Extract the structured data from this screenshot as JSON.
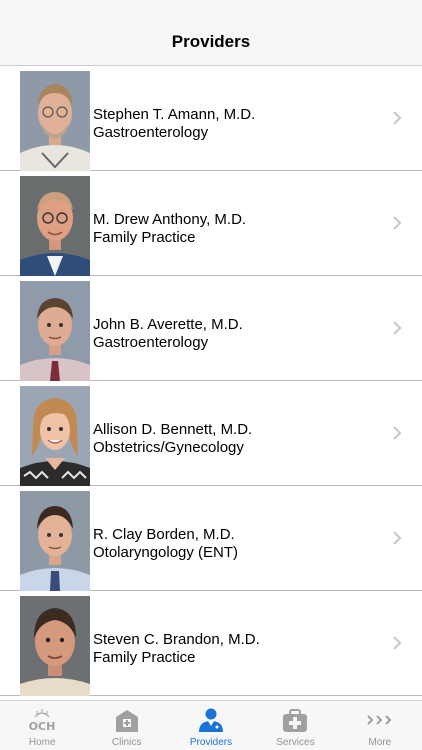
{
  "navbar": {
    "title": "Providers"
  },
  "providers": [
    {
      "name": "Stephen T. Amann, M.D.",
      "specialty": "Gastroenterology"
    },
    {
      "name": "M. Drew Anthony, M.D.",
      "specialty": "Family Practice"
    },
    {
      "name": "John B. Averette, M.D.",
      "specialty": "Gastroenterology"
    },
    {
      "name": "Allison D. Bennett, M.D.",
      "specialty": "Obstetrics/Gynecology"
    },
    {
      "name": "R. Clay Borden, M.D.",
      "specialty": "Otolaryngology (ENT)"
    },
    {
      "name": "Steven C. Brandon, M.D.",
      "specialty": "Family Practice"
    }
  ],
  "tabs": [
    {
      "label": "Home",
      "icon": "och-logo-icon"
    },
    {
      "label": "Clinics",
      "icon": "clinic-building-icon"
    },
    {
      "label": "Providers",
      "icon": "doctor-icon",
      "active": true
    },
    {
      "label": "Services",
      "icon": "medical-kit-icon"
    },
    {
      "label": "More",
      "icon": "more-chevrons-icon"
    }
  ],
  "colors": {
    "active_tab": "#1a73d9",
    "inactive_tab": "#929292",
    "bar_background": "#f7f7f7"
  }
}
